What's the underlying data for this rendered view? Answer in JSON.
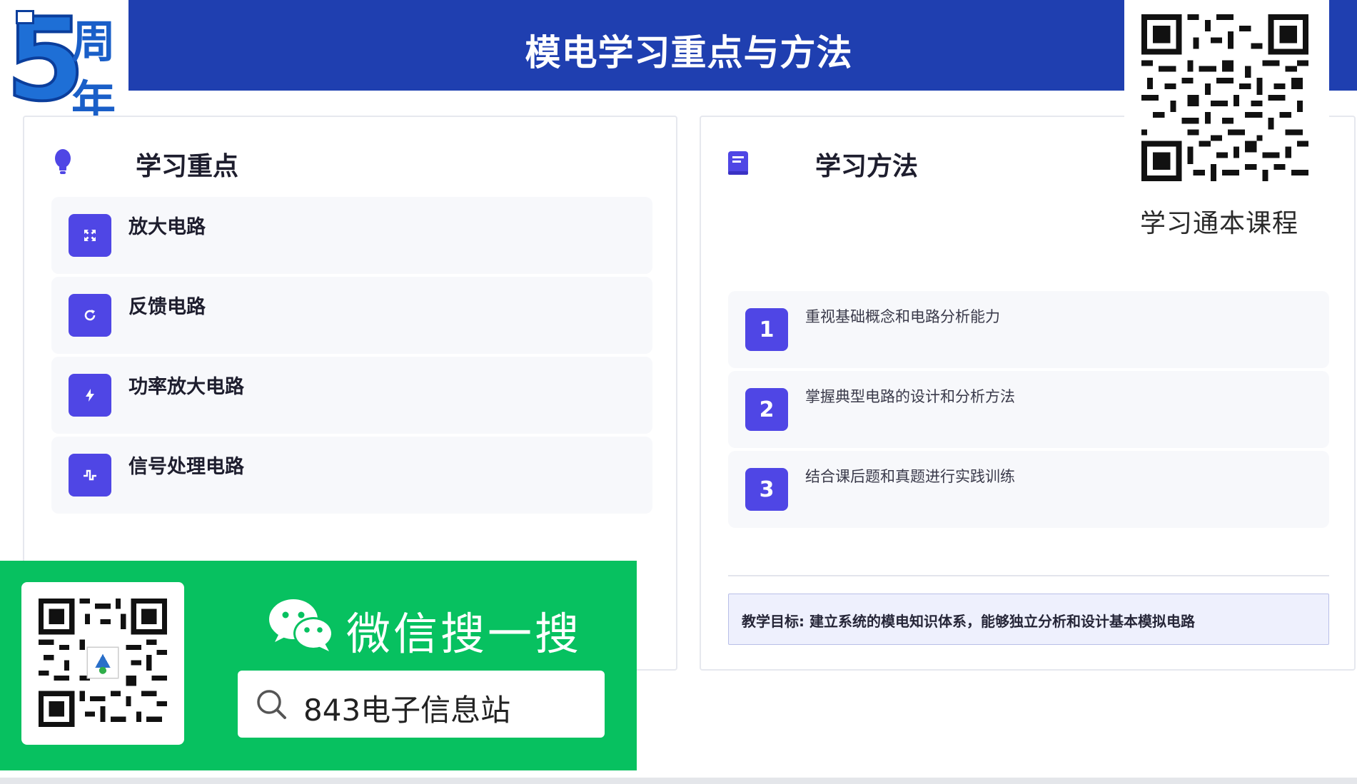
{
  "header": {
    "title": "模电学习重点与方法"
  },
  "logo": {
    "number": "5",
    "line1": "周",
    "line2": "年"
  },
  "focus": {
    "title": "学习重点",
    "icon": "lightbulb-icon",
    "items": [
      {
        "label": "放大电路",
        "icon": "expand-arrows-icon"
      },
      {
        "label": "反馈电路",
        "icon": "refresh-icon"
      },
      {
        "label": "功率放大电路",
        "icon": "bolt-icon"
      },
      {
        "label": "信号处理电路",
        "icon": "waveform-icon"
      }
    ]
  },
  "methods": {
    "title": "学习方法",
    "icon": "book-icon",
    "items": [
      {
        "number": "1",
        "text": "重视基础概念和电路分析能力"
      },
      {
        "number": "2",
        "text": "掌握典型电路的设计和分析方法"
      },
      {
        "number": "3",
        "text": "结合课后题和真题进行实践训练"
      }
    ],
    "goal": "教学目标: 建立系统的模电知识体系，能够独立分析和设计基本模拟电路"
  },
  "qr_panel": {
    "caption": "学习通本课程"
  },
  "wechat": {
    "title": "微信搜一搜",
    "search_text": "843电子信息站"
  },
  "colors": {
    "header_bg": "#1f3fb0",
    "accent": "#4f46e5",
    "wechat_green": "#07c160"
  }
}
